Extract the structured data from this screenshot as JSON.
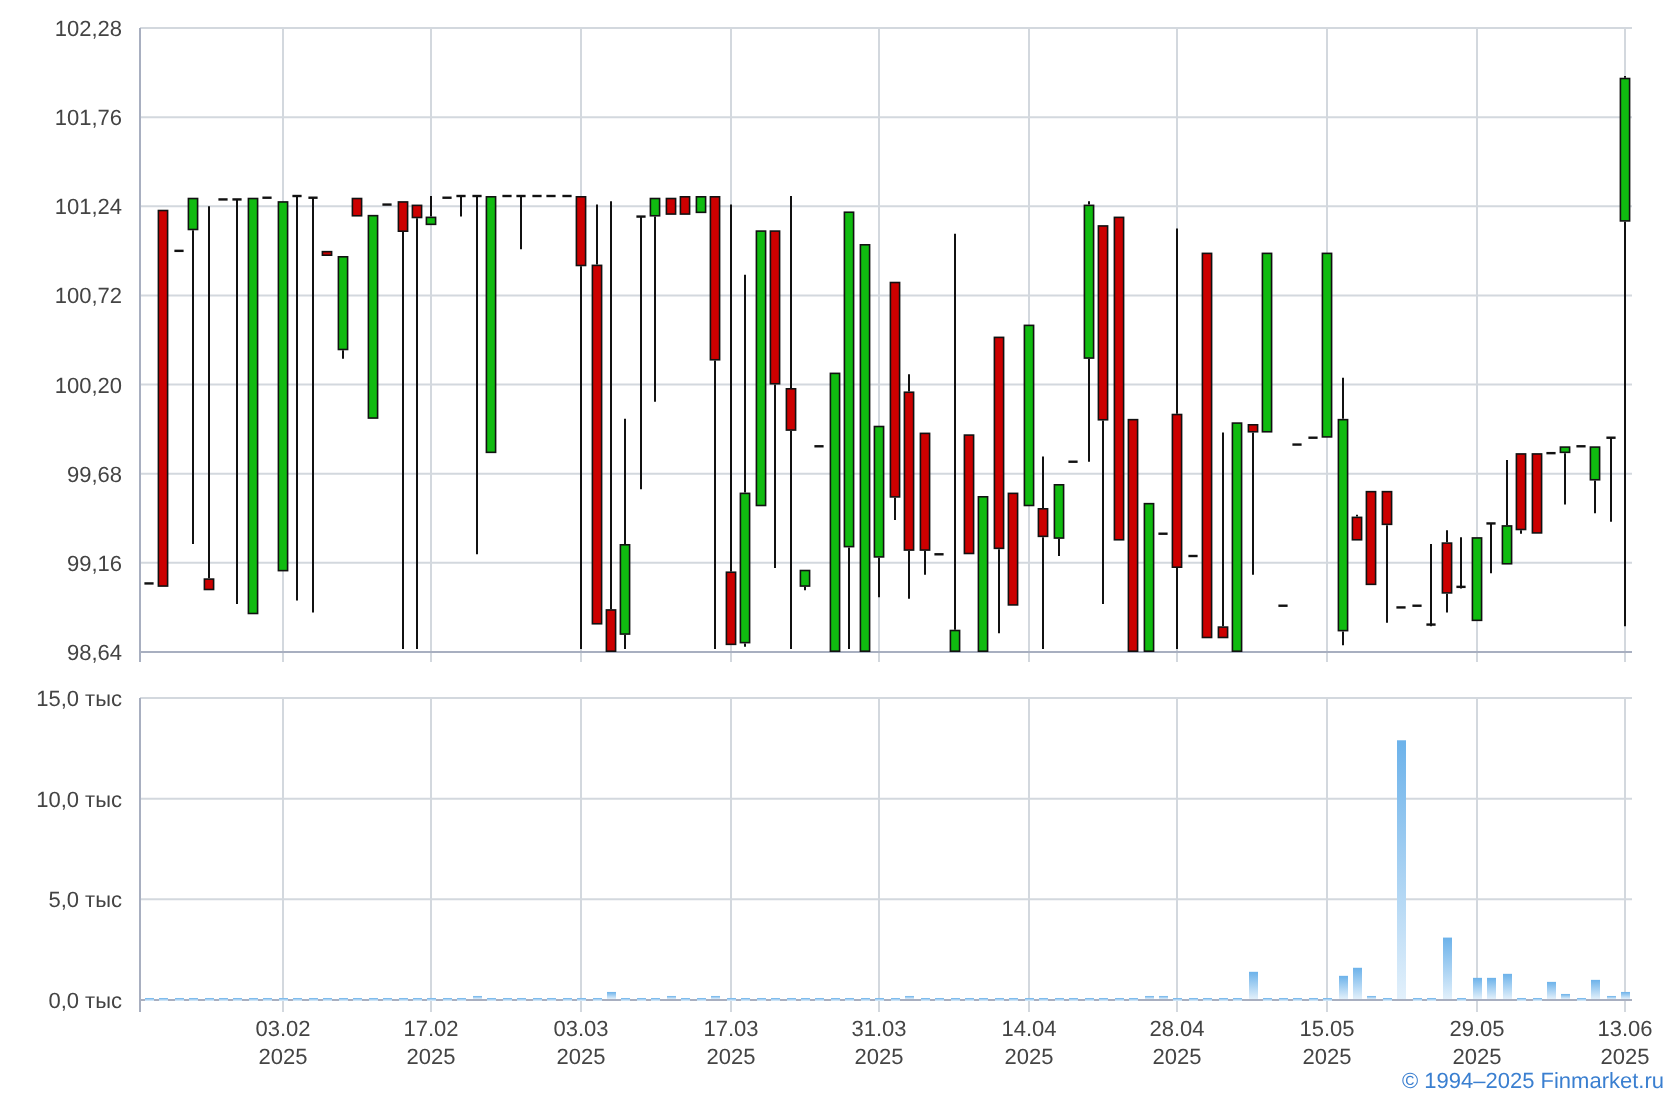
{
  "price_chart": {
    "chart_data": {
      "type": "candlestick",
      "grid": true,
      "categories": [
        null,
        null,
        null,
        null,
        null,
        null,
        null,
        null,
        null,
        null,
        null,
        null,
        null,
        null,
        null,
        null,
        null,
        null,
        null,
        null,
        null,
        null,
        null,
        null,
        null,
        null,
        null,
        null,
        null,
        null,
        null,
        null,
        null,
        null,
        null,
        null,
        null,
        null,
        null,
        null,
        null,
        null,
        null,
        null,
        null,
        null,
        null,
        null,
        null,
        null,
        null,
        null,
        null,
        null,
        null,
        null,
        null,
        null,
        null,
        null,
        null,
        null,
        null,
        null,
        null,
        null,
        null,
        null,
        null,
        null,
        null,
        null,
        null,
        null,
        null,
        null,
        null,
        null,
        null,
        null,
        null,
        null,
        null,
        null,
        null,
        null,
        null,
        null,
        null,
        null,
        null,
        null,
        null,
        null,
        null,
        null,
        null,
        null,
        null,
        null
      ],
      "ylim": [
        98.64,
        102.28
      ],
      "yticks": [
        {
          "value": 98.64,
          "label": "98,64"
        },
        {
          "value": 99.16,
          "label": "99,16"
        },
        {
          "value": 99.68,
          "label": "99,68"
        },
        {
          "value": 100.2,
          "label": "100,20"
        },
        {
          "value": 100.72,
          "label": "100,72"
        },
        {
          "value": 101.24,
          "label": "101,24"
        },
        {
          "value": 101.76,
          "label": "101,76"
        },
        {
          "value": 102.28,
          "label": "102,28"
        }
      ],
      "ohlc": [
        [
          99.04,
          99.04,
          99.04,
          99.04
        ],
        [
          101.22,
          101.22,
          99.02,
          99.02
        ],
        [
          100.98,
          100.98,
          100.98,
          100.98
        ],
        [
          101.1,
          101.29,
          99.27,
          101.29
        ],
        [
          99.07,
          101.24,
          99.0,
          99.0
        ],
        [
          101.28,
          101.28,
          101.28,
          101.28
        ],
        [
          101.28,
          101.28,
          98.92,
          101.28
        ],
        [
          98.86,
          101.29,
          98.86,
          101.29
        ],
        [
          101.29,
          101.29,
          101.29,
          101.29
        ],
        [
          99.11,
          101.27,
          99.11,
          101.27
        ],
        [
          101.3,
          101.3,
          98.94,
          101.3
        ],
        [
          101.29,
          101.29,
          98.87,
          101.29
        ],
        [
          100.98,
          100.98,
          100.95,
          100.95
        ],
        [
          100.4,
          100.95,
          100.35,
          100.95
        ],
        [
          101.29,
          101.29,
          101.18,
          101.18
        ],
        [
          100.0,
          101.19,
          100.0,
          101.19
        ],
        [
          101.25,
          101.25,
          101.25,
          101.25
        ],
        [
          101.27,
          101.27,
          98.64,
          101.09
        ],
        [
          101.25,
          101.25,
          98.64,
          101.17
        ],
        [
          101.13,
          101.3,
          101.13,
          101.18
        ],
        [
          101.29,
          101.29,
          101.29,
          101.29
        ],
        [
          101.3,
          101.3,
          101.18,
          101.3
        ],
        [
          101.3,
          101.3,
          99.21,
          101.3
        ],
        [
          99.8,
          101.3,
          99.8,
          101.3
        ],
        [
          101.3,
          101.3,
          101.3,
          101.3
        ],
        [
          101.3,
          101.3,
          100.99,
          101.3
        ],
        [
          101.3,
          101.3,
          101.3,
          101.3
        ],
        [
          101.3,
          101.3,
          101.3,
          101.3
        ],
        [
          101.3,
          101.3,
          101.3,
          101.3
        ],
        [
          101.3,
          101.3,
          98.64,
          100.89
        ],
        [
          100.9,
          101.25,
          98.8,
          98.8
        ],
        [
          98.89,
          101.27,
          98.64,
          98.64
        ],
        [
          98.74,
          100.0,
          98.64,
          99.27
        ],
        [
          101.18,
          101.18,
          99.59,
          101.18
        ],
        [
          101.18,
          101.29,
          100.1,
          101.29
        ],
        [
          101.29,
          101.29,
          101.19,
          101.19
        ],
        [
          101.3,
          101.3,
          101.19,
          101.19
        ],
        [
          101.2,
          101.3,
          101.2,
          101.3
        ],
        [
          101.3,
          101.3,
          98.64,
          100.34
        ],
        [
          99.11,
          101.25,
          98.68,
          98.68
        ],
        [
          98.69,
          100.84,
          98.67,
          99.57
        ],
        [
          99.49,
          101.1,
          99.49,
          101.1
        ],
        [
          101.1,
          101.1,
          99.13,
          100.2
        ],
        [
          100.18,
          101.3,
          98.64,
          99.93
        ],
        [
          99.02,
          99.12,
          99.0,
          99.12
        ],
        [
          99.84,
          99.84,
          99.84,
          99.84
        ],
        [
          98.64,
          100.27,
          98.64,
          100.27
        ],
        [
          99.25,
          101.21,
          98.64,
          101.21
        ],
        [
          98.64,
          101.02,
          98.64,
          101.02
        ],
        [
          99.19,
          99.96,
          98.96,
          99.96
        ],
        [
          100.8,
          100.8,
          99.41,
          99.54
        ],
        [
          100.16,
          100.26,
          98.95,
          99.23
        ],
        [
          99.92,
          99.92,
          99.09,
          99.23
        ],
        [
          99.21,
          99.21,
          99.21,
          99.21
        ],
        [
          98.64,
          101.08,
          98.64,
          98.77
        ],
        [
          99.91,
          99.91,
          99.21,
          99.21
        ],
        [
          98.64,
          99.55,
          98.64,
          99.55
        ],
        [
          100.48,
          100.48,
          98.75,
          99.24
        ],
        [
          99.57,
          99.57,
          98.91,
          98.91
        ],
        [
          99.49,
          100.55,
          99.49,
          100.55
        ],
        [
          99.48,
          99.78,
          98.64,
          99.31
        ],
        [
          99.3,
          99.62,
          99.2,
          99.62
        ],
        [
          99.75,
          99.75,
          99.75,
          99.75
        ],
        [
          100.35,
          101.27,
          99.75,
          101.25
        ],
        [
          101.13,
          101.13,
          98.92,
          99.99
        ],
        [
          101.18,
          101.18,
          99.29,
          99.29
        ],
        [
          100.0,
          100.0,
          98.64,
          98.64
        ],
        [
          98.64,
          99.51,
          98.64,
          99.51
        ],
        [
          99.33,
          99.33,
          99.33,
          99.33
        ],
        [
          100.03,
          101.11,
          98.64,
          99.13
        ],
        [
          99.2,
          99.2,
          99.2,
          99.2
        ],
        [
          100.97,
          100.97,
          98.72,
          98.72
        ],
        [
          98.79,
          99.92,
          98.72,
          98.72
        ],
        [
          98.64,
          99.98,
          98.64,
          99.98
        ],
        [
          99.97,
          99.97,
          99.09,
          99.92
        ],
        [
          99.92,
          100.97,
          99.92,
          100.97
        ],
        [
          98.91,
          98.91,
          98.91,
          98.91
        ],
        [
          99.85,
          99.85,
          99.85,
          99.85
        ],
        [
          99.89,
          99.89,
          99.89,
          99.89
        ],
        [
          99.89,
          100.97,
          99.89,
          100.97
        ],
        [
          98.76,
          100.24,
          98.68,
          100.0
        ],
        [
          99.43,
          99.44,
          99.29,
          99.29
        ],
        [
          99.58,
          99.58,
          99.03,
          99.03
        ],
        [
          99.58,
          99.58,
          98.81,
          99.38
        ],
        [
          98.9,
          98.9,
          98.9,
          98.9
        ],
        [
          98.91,
          98.91,
          98.91,
          98.91
        ],
        [
          98.8,
          99.27,
          98.79,
          98.8
        ],
        [
          99.28,
          99.35,
          98.87,
          98.98
        ],
        [
          99.02,
          99.31,
          99.01,
          99.02
        ],
        [
          98.82,
          99.31,
          98.82,
          99.31
        ],
        [
          99.39,
          99.39,
          99.1,
          99.39
        ],
        [
          99.15,
          99.76,
          99.15,
          99.38
        ],
        [
          99.8,
          99.8,
          99.33,
          99.35
        ],
        [
          99.8,
          99.8,
          99.33,
          99.33
        ],
        [
          99.8,
          99.8,
          99.8,
          99.8
        ],
        [
          99.8,
          99.84,
          99.5,
          99.84
        ],
        [
          99.84,
          99.84,
          99.84,
          99.84
        ],
        [
          99.64,
          99.84,
          99.45,
          99.84
        ],
        [
          99.89,
          99.89,
          99.4,
          99.89
        ],
        [
          101.15,
          102.0,
          98.79,
          101.99
        ]
      ]
    }
  },
  "volume_chart": {
    "chart_data": {
      "type": "bar",
      "grid": true,
      "ylim": [
        0,
        15
      ],
      "yticks": [
        {
          "value": 0,
          "label": "0,0 тыс"
        },
        {
          "value": 5,
          "label": "5,0 тыс"
        },
        {
          "value": 10,
          "label": "10,0 тыс"
        },
        {
          "value": 15,
          "label": "15,0 тыс"
        }
      ],
      "categories": [
        null,
        null,
        null,
        null,
        null,
        null,
        null,
        null,
        null,
        "03.02\n2025",
        null,
        null,
        null,
        null,
        null,
        null,
        null,
        null,
        null,
        "17.02\n2025",
        null,
        null,
        null,
        null,
        null,
        null,
        null,
        null,
        null,
        "03.03\n2025",
        null,
        null,
        null,
        null,
        null,
        null,
        null,
        null,
        null,
        "17.03\n2025",
        null,
        null,
        null,
        null,
        null,
        null,
        null,
        null,
        null,
        "31.03\n2025",
        null,
        null,
        null,
        null,
        null,
        null,
        null,
        null,
        null,
        "14.04\n2025",
        null,
        null,
        null,
        null,
        null,
        null,
        null,
        null,
        null,
        "28.04\n2025",
        null,
        null,
        null,
        null,
        null,
        null,
        null,
        null,
        null,
        "15.05\n2025",
        null,
        null,
        null,
        null,
        null,
        null,
        null,
        null,
        null,
        "29.05\n2025",
        null,
        null,
        null,
        null,
        null,
        null,
        null,
        null,
        null,
        "13.06\n2025"
      ],
      "series": [
        {
          "color": "#6cb2ea",
          "values": [
            0.1,
            0.1,
            0.1,
            0.1,
            0.1,
            0.1,
            0.1,
            0.1,
            0.1,
            0.1,
            0.1,
            0.1,
            0.1,
            0.1,
            0.1,
            0.1,
            0.1,
            0.1,
            0.1,
            0.1,
            0.1,
            0.1,
            0.2,
            0.1,
            0.1,
            0.1,
            0.1,
            0.1,
            0.1,
            0.1,
            0.1,
            0.4,
            0.1,
            0.1,
            0.1,
            0.2,
            0.1,
            0.1,
            0.2,
            0.1,
            0.1,
            0.1,
            0.1,
            0.1,
            0.1,
            0.1,
            0.1,
            0.1,
            0.1,
            0.1,
            0.1,
            0.2,
            0.1,
            0.1,
            0.1,
            0.1,
            0.1,
            0.1,
            0.1,
            0.1,
            0.1,
            0.1,
            0.1,
            0.1,
            0.1,
            0.1,
            0.1,
            0.2,
            0.2,
            0.1,
            0.1,
            0.1,
            0.1,
            0.1,
            1.4,
            0.1,
            0.1,
            0.1,
            0.1,
            0.1,
            1.2,
            1.6,
            0.2,
            0.1,
            12.9,
            0.1,
            0.1,
            3.1,
            0.1,
            1.1,
            1.1,
            1.3,
            0.1,
            0.1,
            0.9,
            0.3,
            0.1,
            1.0,
            0.2,
            0.4
          ]
        }
      ]
    }
  },
  "footer": {
    "copyright": "© 1994–2025 Finmarket.ru"
  }
}
